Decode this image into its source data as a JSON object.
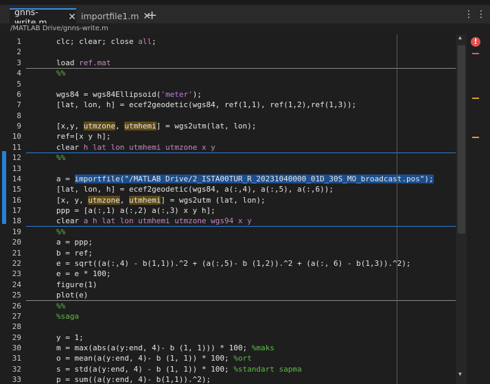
{
  "tabs": [
    {
      "label": "gnns-write.m",
      "close": "✕",
      "active": true
    },
    {
      "label": "importfile1.m",
      "close": "✕",
      "active": false
    }
  ],
  "new_tab": "+",
  "menu": "⋮",
  "file_path": "/MATLAB Drive/gnns-write.m",
  "error_icon": "!",
  "colors": {
    "accent": "#2a7fd6",
    "highlight": "#5e4a16",
    "selection": "#1d4e8c",
    "keyword": "#c586c0",
    "comment": "#5fb94a",
    "error": "#e35050",
    "warning": "#e0a020"
  },
  "lines": [
    {
      "n": "1",
      "segs": [
        [
          "p",
          "clc; clear; close "
        ],
        [
          "kw",
          "all"
        ],
        [
          "p",
          ";"
        ]
      ]
    },
    {
      "n": "2",
      "segs": []
    },
    {
      "n": "3",
      "segs": [
        [
          "p",
          "load "
        ],
        [
          "kw",
          "ref.mat"
        ]
      ]
    },
    {
      "n": "4",
      "segs": [
        [
          "sec",
          "%%"
        ]
      ]
    },
    {
      "n": "5",
      "segs": []
    },
    {
      "n": "6",
      "segs": [
        [
          "p",
          "wgs84 = wgs84Ellipsoid("
        ],
        [
          "str",
          "'meter'"
        ],
        [
          "p",
          ");"
        ]
      ]
    },
    {
      "n": "7",
      "segs": [
        [
          "p",
          "[lat, lon, h] = ecef2geodetic(wgs84, ref(1,1), ref(1,2),ref(1,3));"
        ]
      ]
    },
    {
      "n": "8",
      "segs": []
    },
    {
      "n": "9",
      "segs": [
        [
          "p",
          "[x,y, "
        ],
        [
          "hl",
          "utmzone"
        ],
        [
          "p",
          ", "
        ],
        [
          "hl",
          "utmhemi"
        ],
        [
          "p",
          "] = wgs2utm(lat, lon);"
        ]
      ]
    },
    {
      "n": "10",
      "segs": [
        [
          "p",
          "ref=[x y h];"
        ]
      ]
    },
    {
      "n": "11",
      "segs": [
        [
          "p",
          "clear "
        ],
        [
          "kw",
          "h lat lon utmhemi utmzone x y"
        ]
      ]
    },
    {
      "n": "12",
      "segs": [
        [
          "sec",
          "%%"
        ]
      ]
    },
    {
      "n": "13",
      "segs": []
    },
    {
      "n": "14",
      "segs": [
        [
          "p",
          "a = "
        ],
        [
          "sel",
          "importfile(\"/MATLAB Drive/2_ISTA00TUR_R_20231040000_01D_30S_MO_broadcast.pos\");"
        ]
      ]
    },
    {
      "n": "15",
      "segs": [
        [
          "p",
          "[lat, lon, h] = ecef2geodetic(wgs84, a(:,4), a(:,5), a(:,6));"
        ]
      ]
    },
    {
      "n": "16",
      "segs": [
        [
          "p",
          "[x, y, "
        ],
        [
          "hl",
          "utmzone"
        ],
        [
          "p",
          ", "
        ],
        [
          "hl",
          "utmhemi"
        ],
        [
          "p",
          "] = wgs2utm (lat, lon);"
        ]
      ]
    },
    {
      "n": "17",
      "segs": [
        [
          "p",
          "ppp = [a(:,1) a(:,2) a(:,3) x y h];"
        ]
      ]
    },
    {
      "n": "18",
      "segs": [
        [
          "p",
          "clear "
        ],
        [
          "kw",
          "a h lat lon utmhemi utmzone wgs94 x y"
        ]
      ]
    },
    {
      "n": "19",
      "segs": [
        [
          "sec",
          "%%"
        ]
      ]
    },
    {
      "n": "20",
      "segs": [
        [
          "p",
          "a = ppp;"
        ]
      ]
    },
    {
      "n": "21",
      "segs": [
        [
          "p",
          "b = ref;"
        ]
      ]
    },
    {
      "n": "22",
      "segs": [
        [
          "p",
          "e = sqrt((a(:,4) - b(1,1)).^2 + (a(:,5)- b (1,2)).^2 + (a(:, 6) - b(1,3)).^2);"
        ]
      ]
    },
    {
      "n": "23",
      "segs": [
        [
          "p",
          "e = e * 100;"
        ]
      ]
    },
    {
      "n": "24",
      "segs": [
        [
          "p",
          "figure(1)"
        ]
      ]
    },
    {
      "n": "25",
      "segs": [
        [
          "p",
          "plot(e)"
        ]
      ]
    },
    {
      "n": "26",
      "segs": [
        [
          "sec",
          "%%"
        ]
      ]
    },
    {
      "n": "27",
      "segs": [
        [
          "cmt",
          "%saga"
        ]
      ]
    },
    {
      "n": "28",
      "segs": []
    },
    {
      "n": "29",
      "segs": [
        [
          "p",
          "y = 1;"
        ]
      ]
    },
    {
      "n": "30",
      "segs": [
        [
          "p",
          "m = max(abs(a(y:end, 4)- b (1, 1))) * 100; "
        ],
        [
          "cmt",
          "%maks"
        ]
      ]
    },
    {
      "n": "31",
      "segs": [
        [
          "p",
          "o = mean(a(y:end, 4)- b (1, 1)) * 100; "
        ],
        [
          "cmt",
          "%ort"
        ]
      ]
    },
    {
      "n": "32",
      "segs": [
        [
          "p",
          "s = std(a(y:end, 4) - b (1, 1)) * 100; "
        ],
        [
          "cmt",
          "%standart sapma"
        ]
      ]
    },
    {
      "n": "33",
      "segs": [
        [
          "p",
          "p = sum((a(y:end, 4)- b(1,1)).^2);"
        ]
      ]
    }
  ]
}
